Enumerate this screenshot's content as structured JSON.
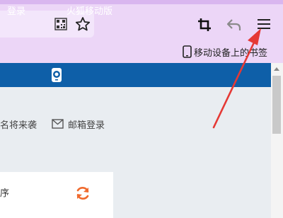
{
  "toolbar": {
    "icons": [
      "qr-code-icon",
      "star-icon",
      "crop-icon",
      "undo-icon",
      "hamburger-menu-icon"
    ]
  },
  "bookmarks_bar": {
    "mobile_bookmarks_label": "移动设备上的书签",
    "icon": "phone-icon"
  },
  "site_nav": {
    "login_label": "登录",
    "firefox_mobile_label": "火狐移动版",
    "firefox_icon": "firefox-phone-icon"
  },
  "page": {
    "slogan_fragment": "名将来袭",
    "mail_login_label": "邮箱登录",
    "mail_icon": "mail-icon",
    "panel_text_fragment": "序",
    "refresh_icon": "refresh-icon"
  },
  "colors": {
    "chrome_bg": "#ecd6f7",
    "nav_bg": "#0e5fa8",
    "annotation_arrow": "#e53935",
    "refresh_accent": "#f06a2e"
  }
}
